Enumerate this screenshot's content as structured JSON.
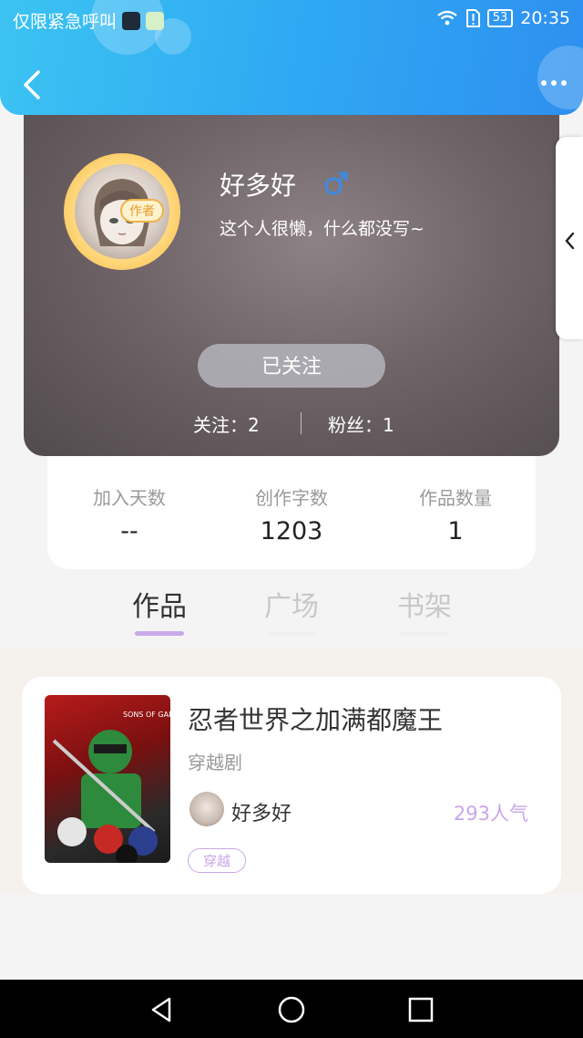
{
  "status_bar": {
    "carrier": "仅限紧急呼叫",
    "battery": "53",
    "time": "20:35"
  },
  "profile": {
    "avatar_badge": "作者",
    "name": "好多好",
    "bio": "这个人很懒，什么都没写~",
    "follow_button": "已关注",
    "following": "关注：2",
    "followers": "粉丝：1"
  },
  "counts": [
    {
      "label": "加入天数",
      "value": "--"
    },
    {
      "label": "创作字数",
      "value": "1203"
    },
    {
      "label": "作品数量",
      "value": "1"
    }
  ],
  "tabs": [
    {
      "label": "作品",
      "active": true
    },
    {
      "label": "广场",
      "active": false
    },
    {
      "label": "书架",
      "active": false
    }
  ],
  "work": {
    "title": "忍者世界之加满都魔王",
    "genre": "穿越剧",
    "author": "好多好",
    "popularity": "293人气",
    "tag": "穿越",
    "cover_text": "SONS OF GARMADON"
  },
  "colors": {
    "header": "#2fa9f3",
    "accent": "#c9a6e9"
  },
  "icons": [
    "back-arrow-icon",
    "more-dots-icon",
    "male-gender-icon",
    "chevron-left-icon",
    "nav-back-icon",
    "nav-home-icon",
    "nav-recent-icon"
  ]
}
